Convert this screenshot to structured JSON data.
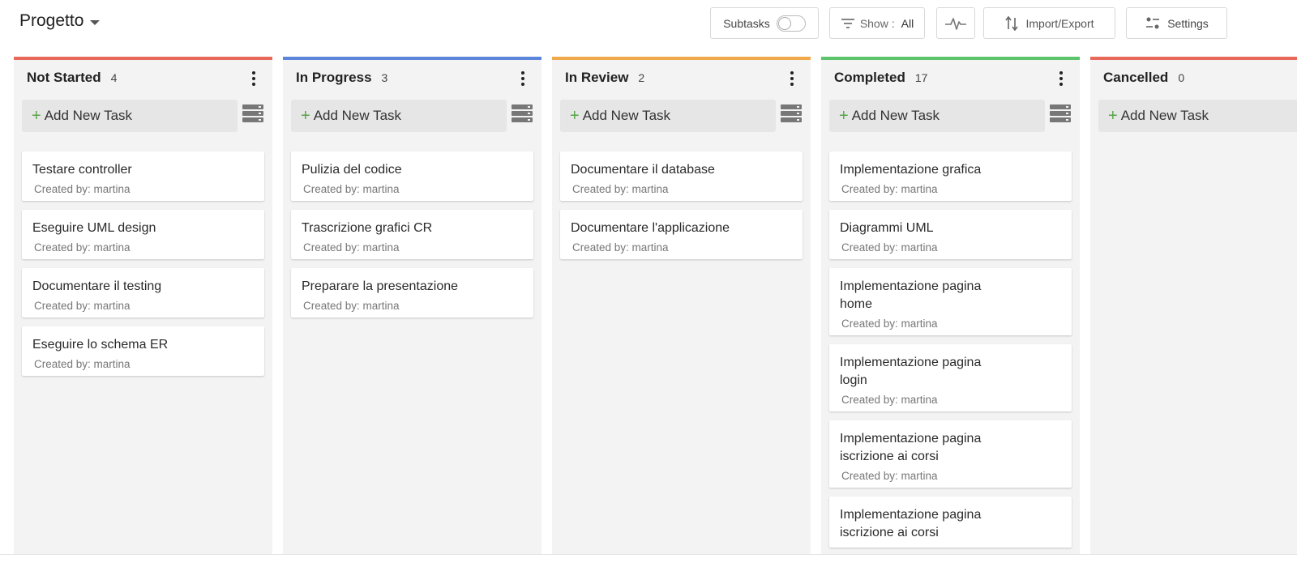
{
  "header": {
    "project_name": "Progetto",
    "subtasks_label": "Subtasks",
    "show_label": "Show :",
    "show_value": "All",
    "import_export_label": "Import/Export",
    "settings_label": "Settings"
  },
  "add_task_label": "Add New Task",
  "columns": [
    {
      "title": "Not Started",
      "count": "4",
      "color": "#e8685a",
      "tasks": [
        {
          "title": "Testare controller",
          "meta": "Created by: martina"
        },
        {
          "title": "Eseguire UML design",
          "meta": "Created by: martina"
        },
        {
          "title": "Documentare il testing",
          "meta": "Created by: martina"
        },
        {
          "title": "Eseguire lo schema ER",
          "meta": "Created by: martina"
        }
      ]
    },
    {
      "title": "In Progress",
      "count": "3",
      "color": "#5b86d9",
      "tasks": [
        {
          "title": "Pulizia del codice",
          "meta": "Created by: martina"
        },
        {
          "title": "Trascrizione grafici CR",
          "meta": "Created by: martina"
        },
        {
          "title": "Preparare la presentazione",
          "meta": "Created by: martina"
        }
      ]
    },
    {
      "title": "In Review",
      "count": "2",
      "color": "#f0a94a",
      "tasks": [
        {
          "title": "Documentare il database",
          "meta": "Created by: martina"
        },
        {
          "title": "Documentare l'applicazione",
          "meta": "Created by: martina"
        }
      ]
    },
    {
      "title": "Completed",
      "count": "17",
      "color": "#5cc46a",
      "tasks": [
        {
          "title": "Implementazione grafica",
          "meta": "Created by: martina"
        },
        {
          "title": "Diagrammi UML",
          "meta": "Created by: martina"
        },
        {
          "title": "Implementazione pagina home",
          "meta": "Created by: martina"
        },
        {
          "title": "Implementazione pagina login",
          "meta": "Created by: martina"
        },
        {
          "title": "Implementazione pagina iscrizione ai corsi",
          "meta": "Created by: martina"
        },
        {
          "title": "Implementazione pagina iscrizione ai corsi",
          "meta": ""
        }
      ]
    },
    {
      "title": "Cancelled",
      "count": "0",
      "color": "#e8685a",
      "tasks": []
    }
  ]
}
